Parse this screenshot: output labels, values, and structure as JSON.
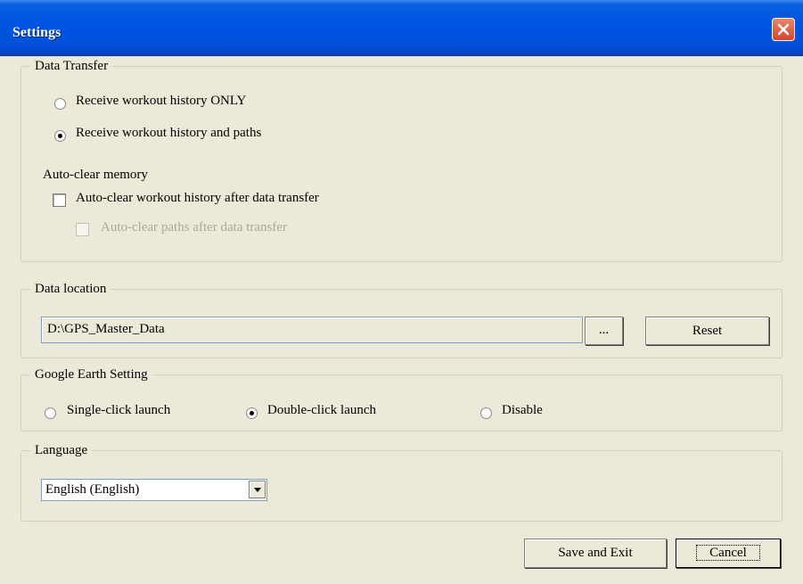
{
  "window": {
    "title": "Settings"
  },
  "data_transfer": {
    "legend": "Data Transfer",
    "options": [
      {
        "label": "Receive workout history ONLY",
        "selected": false
      },
      {
        "label": "Receive workout history and paths",
        "selected": true
      }
    ],
    "autoclear_label": "Auto-clear memory",
    "autoclear_history": {
      "label": "Auto-clear workout history after data transfer",
      "checked": false,
      "enabled": true
    },
    "autoclear_paths": {
      "label": "Auto-clear paths after data transfer",
      "checked": false,
      "enabled": false
    }
  },
  "data_location": {
    "legend": "Data location",
    "path": "D:\\GPS_Master_Data",
    "browse_label": "...",
    "reset_label": "Reset"
  },
  "google_earth": {
    "legend": "Google Earth Setting",
    "options": [
      {
        "label": "Single-click launch",
        "selected": false
      },
      {
        "label": "Double-click launch",
        "selected": true
      },
      {
        "label": "Disable",
        "selected": false
      }
    ]
  },
  "language": {
    "legend": "Language",
    "selected": "English (English)"
  },
  "footer": {
    "save_label": "Save and Exit",
    "cancel_label": "Cancel"
  }
}
